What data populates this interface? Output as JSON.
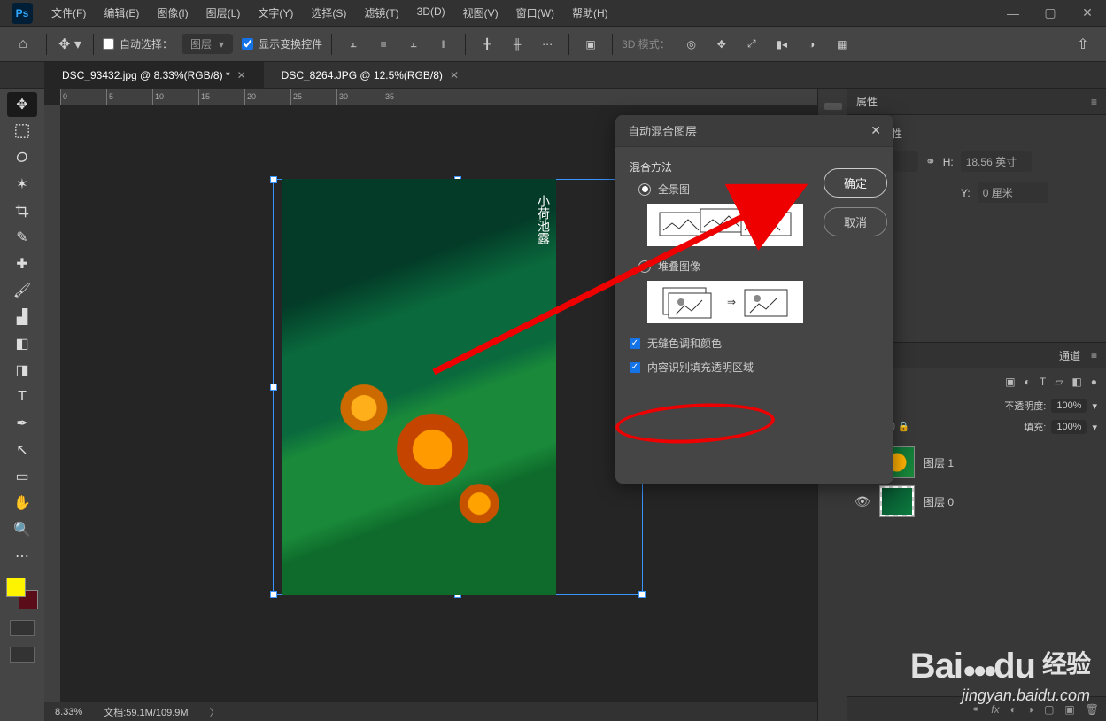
{
  "menu": [
    "文件(F)",
    "编辑(E)",
    "图像(I)",
    "图层(L)",
    "文字(Y)",
    "选择(S)",
    "滤镜(T)",
    "3D(D)",
    "视图(V)",
    "窗口(W)",
    "帮助(H)"
  ],
  "options": {
    "auto_select_label": "自动选择：",
    "dropdown": "图层",
    "show_transform": "显示变换控件",
    "mode_3d": "3D 模式："
  },
  "tabs": [
    {
      "label": "DSC_93432.jpg @ 8.33%(RGB/8) *",
      "active": true
    },
    {
      "label": "DSC_8264.JPG @ 12.5%(RGB/8)",
      "active": false
    }
  ],
  "ruler_ticks": [
    "0",
    "5",
    "10",
    "15",
    "20",
    "25",
    "30",
    "35"
  ],
  "photo_caption": "小荷池露",
  "status": {
    "zoom": "8.33%",
    "doc": "文档:59.1M/109.9M"
  },
  "dialog": {
    "title": "自动混合图层",
    "section": "混合方法",
    "opt_panorama": "全景图",
    "opt_stack": "堆叠图像",
    "cb_seamless": "无缝色调和颜色",
    "cb_content": "内容识别填充透明区域",
    "ok": "确定",
    "cancel": "取消"
  },
  "properties": {
    "tab": "属性",
    "section": "图层属性",
    "unit": "英寸",
    "h_label": "H:",
    "h_val": "18.56 英寸",
    "y_label": "Y:",
    "y_val": "0 厘米"
  },
  "channels_tab": "通道",
  "layers": {
    "opacity_label": "不透明度:",
    "opacity_val": "100%",
    "fill_label": "填充:",
    "fill_val": "100%",
    "items": [
      {
        "name": "图层 1"
      },
      {
        "name": "图层 0"
      }
    ]
  },
  "watermark": {
    "brand": "Bai",
    "brand2": "du",
    "cn": "经验",
    "url": "jingyan.baidu.com"
  }
}
